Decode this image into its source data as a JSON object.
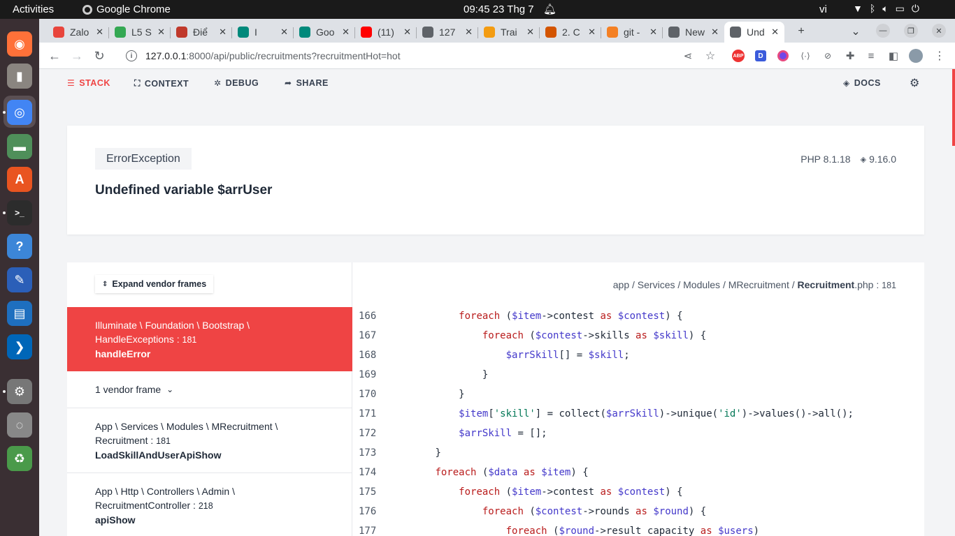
{
  "system": {
    "activities": "Activities",
    "app_name": "Google Chrome",
    "clock": "09:45  23 Thg 7",
    "lang": "vi"
  },
  "dock": [
    {
      "name": "firefox",
      "color": "#ff7139",
      "glyph": "◉"
    },
    {
      "name": "text-editor",
      "color": "#8a8580",
      "glyph": "▮"
    },
    {
      "name": "chrome",
      "color": "#4285f4",
      "glyph": "◎"
    },
    {
      "name": "files",
      "color": "#4f8f5a",
      "glyph": "▬"
    },
    {
      "name": "app-center",
      "color": "#e95420",
      "glyph": "A"
    },
    {
      "name": "terminal",
      "color": "#2c2c2c",
      "glyph": ">_"
    },
    {
      "name": "help",
      "color": "#3c86d8",
      "glyph": "?"
    },
    {
      "name": "notes",
      "color": "#2b5fb8",
      "glyph": "✎"
    },
    {
      "name": "libreoffice",
      "color": "#1e6fbf",
      "glyph": "▤"
    },
    {
      "name": "vscode",
      "color": "#0066b8",
      "glyph": "❯"
    },
    {
      "name": "settings",
      "color": "#777777",
      "glyph": "⚙"
    },
    {
      "name": "disk",
      "color": "#888888",
      "glyph": "◌"
    },
    {
      "name": "trash",
      "color": "#4a9a4a",
      "glyph": "♻"
    }
  ],
  "tabs": [
    {
      "label": "Zalo",
      "color": "#e8453c"
    },
    {
      "label": "L5 S",
      "color": "#34a853"
    },
    {
      "label": "Điể",
      "color": "#c0392b"
    },
    {
      "label": "I",
      "color": "#00897b"
    },
    {
      "label": "Goo",
      "color": "#00897b"
    },
    {
      "label": "(11)",
      "color": "#ff0000"
    },
    {
      "label": "127",
      "color": "#5f6368"
    },
    {
      "label": "Trai",
      "color": "#f39c12"
    },
    {
      "label": "2. C",
      "color": "#d35400"
    },
    {
      "label": "git -",
      "color": "#f48024"
    },
    {
      "label": "New",
      "color": "#5f6368"
    },
    {
      "label": "Und",
      "color": "#5f6368"
    }
  ],
  "url": {
    "host": "127.0.0.1",
    "path": ":8000/api/public/recruitments?recruitmentHot=hot"
  },
  "ignition_nav": {
    "stack": "STACK",
    "context": "CONTEXT",
    "debug": "DEBUG",
    "share": "SHARE",
    "docs": "DOCS"
  },
  "error": {
    "exception_class": "ErrorException",
    "message": "Undefined variable $arrUser",
    "php_version": "PHP 8.1.18",
    "laravel_version": "9.16.0"
  },
  "stack": {
    "expand_label": "Expand vendor frames",
    "active_frame": {
      "class": "Illuminate \\ Foundation \\ Bootstrap \\",
      "class2": "HandleExceptions",
      "line": "181",
      "method": "handleError"
    },
    "vendor_label": "1 vendor frame",
    "frame2": {
      "class": "App \\ Services \\ Modules \\ MRecruitment \\",
      "class2": "Recruitment",
      "line": "181",
      "method": "LoadSkillAndUserApiShow"
    },
    "frame3": {
      "class": "App \\ Http \\ Controllers \\ Admin \\",
      "class2": "RecruitmentController",
      "line": "218",
      "method": "apiShow"
    }
  },
  "file": {
    "dir": "app / Services / Modules / MRecruitment / ",
    "name": "Recruitment",
    "ext": ".php",
    "line": "181"
  },
  "code_lines": [
    {
      "no": "166",
      "indent": 12,
      "tokens": [
        [
          "kw",
          "foreach"
        ],
        [
          "t",
          " ("
        ],
        [
          "var",
          "$item"
        ],
        [
          "t",
          "->contest "
        ],
        [
          "kw",
          "as"
        ],
        [
          "t",
          " "
        ],
        [
          "var",
          "$contest"
        ],
        [
          "t",
          ") {"
        ]
      ]
    },
    {
      "no": "167",
      "indent": 16,
      "tokens": [
        [
          "kw",
          "foreach"
        ],
        [
          "t",
          " ("
        ],
        [
          "var",
          "$contest"
        ],
        [
          "t",
          "->skills "
        ],
        [
          "kw",
          "as"
        ],
        [
          "t",
          " "
        ],
        [
          "var",
          "$skill"
        ],
        [
          "t",
          ") {"
        ]
      ]
    },
    {
      "no": "168",
      "indent": 20,
      "tokens": [
        [
          "var",
          "$arrSkill"
        ],
        [
          "t",
          "[] = "
        ],
        [
          "var",
          "$skill"
        ],
        [
          "t",
          ";"
        ]
      ]
    },
    {
      "no": "169",
      "indent": 16,
      "tokens": [
        [
          "t",
          "}"
        ]
      ]
    },
    {
      "no": "170",
      "indent": 12,
      "tokens": [
        [
          "t",
          "}"
        ]
      ]
    },
    {
      "no": "171",
      "indent": 12,
      "tokens": [
        [
          "var",
          "$item"
        ],
        [
          "t",
          "["
        ],
        [
          "str",
          "'skill'"
        ],
        [
          "t",
          "] = collect("
        ],
        [
          "var",
          "$arrSkill"
        ],
        [
          "t",
          ")->unique("
        ],
        [
          "str",
          "'id'"
        ],
        [
          "t",
          ")->values()->all();"
        ]
      ]
    },
    {
      "no": "172",
      "indent": 12,
      "tokens": [
        [
          "var",
          "$arrSkill"
        ],
        [
          "t",
          " = [];"
        ]
      ]
    },
    {
      "no": "173",
      "indent": 8,
      "tokens": [
        [
          "t",
          "}"
        ]
      ]
    },
    {
      "no": "174",
      "indent": 8,
      "tokens": [
        [
          "kw",
          "foreach"
        ],
        [
          "t",
          " ("
        ],
        [
          "var",
          "$data"
        ],
        [
          "t",
          " "
        ],
        [
          "kw",
          "as"
        ],
        [
          "t",
          " "
        ],
        [
          "var",
          "$item"
        ],
        [
          "t",
          ") {"
        ]
      ]
    },
    {
      "no": "175",
      "indent": 12,
      "tokens": [
        [
          "kw",
          "foreach"
        ],
        [
          "t",
          " ("
        ],
        [
          "var",
          "$item"
        ],
        [
          "t",
          "->contest "
        ],
        [
          "kw",
          "as"
        ],
        [
          "t",
          " "
        ],
        [
          "var",
          "$contest"
        ],
        [
          "t",
          ") {"
        ]
      ]
    },
    {
      "no": "176",
      "indent": 16,
      "tokens": [
        [
          "kw",
          "foreach"
        ],
        [
          "t",
          " ("
        ],
        [
          "var",
          "$contest"
        ],
        [
          "t",
          "->rounds "
        ],
        [
          "kw",
          "as"
        ],
        [
          "t",
          " "
        ],
        [
          "var",
          "$round"
        ],
        [
          "t",
          ") {"
        ]
      ]
    },
    {
      "no": "177",
      "indent": 20,
      "tokens": [
        [
          "kw",
          "foreach"
        ],
        [
          "t",
          " ("
        ],
        [
          "var",
          "$round"
        ],
        [
          "t",
          "->result_capacity "
        ],
        [
          "kw",
          "as"
        ],
        [
          "t",
          " "
        ],
        [
          "var",
          "$users"
        ],
        [
          "t",
          ")"
        ]
      ]
    }
  ]
}
